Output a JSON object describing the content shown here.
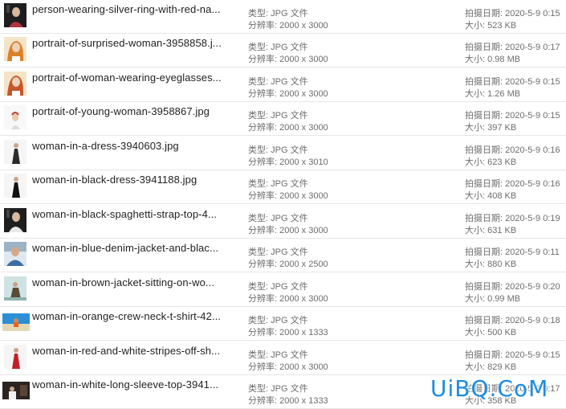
{
  "labels": {
    "type": "类型: ",
    "resolution": "分辨率: ",
    "date_taken": "拍摄日期: ",
    "size": "大小: "
  },
  "files": [
    {
      "name": "person-wearing-silver-ring-with-red-na...",
      "type": "JPG 文件",
      "resolution": "2000 x 3000",
      "date": "2020-5-9 0:15",
      "size": "523 KB",
      "thumb": "portrait-dark",
      "accent": "#b0323c"
    },
    {
      "name": "portrait-of-surprised-woman-3958858.j...",
      "type": "JPG 文件",
      "resolution": "2000 x 3000",
      "date": "2020-5-9 0:17",
      "size": "0.98 MB",
      "thumb": "portrait-warm",
      "accent": "#d9822b"
    },
    {
      "name": "portrait-of-woman-wearing-eyeglasses...",
      "type": "JPG 文件",
      "resolution": "2000 x 3000",
      "date": "2020-5-9 0:15",
      "size": "1.26 MB",
      "thumb": "portrait-warm",
      "accent": "#c8552a"
    },
    {
      "name": "portrait-of-young-woman-3958867.jpg",
      "type": "JPG 文件",
      "resolution": "2000 x 3000",
      "date": "2020-5-9 0:15",
      "size": "397 KB",
      "thumb": "portrait-light",
      "accent": "#c23a3a"
    },
    {
      "name": "woman-in-a-dress-3940603.jpg",
      "type": "JPG 文件",
      "resolution": "2000 x 3010",
      "date": "2020-5-9 0:16",
      "size": "623 KB",
      "thumb": "figure-light",
      "accent": "#2c2c2c"
    },
    {
      "name": "woman-in-black-dress-3941188.jpg",
      "type": "JPG 文件",
      "resolution": "2000 x 3000",
      "date": "2020-5-9 0:16",
      "size": "408 KB",
      "thumb": "figure-light",
      "accent": "#111111"
    },
    {
      "name": "woman-in-black-spaghetti-strap-top-4...",
      "type": "JPG 文件",
      "resolution": "2000 x 3000",
      "date": "2020-5-9 0:19",
      "size": "631 KB",
      "thumb": "portrait-dark",
      "accent": "#e8e8e8"
    },
    {
      "name": "woman-in-blue-denim-jacket-and-blac...",
      "type": "JPG 文件",
      "resolution": "2000 x 2500",
      "date": "2020-5-9 0:11",
      "size": "880 KB",
      "thumb": "portrait-blue",
      "accent": "#3a6ea5"
    },
    {
      "name": "woman-in-brown-jacket-sitting-on-wo...",
      "type": "JPG 文件",
      "resolution": "2000 x 3000",
      "date": "2020-5-9 0:20",
      "size": "0.99 MB",
      "thumb": "figure-teal",
      "accent": "#5b4a3a"
    },
    {
      "name": "woman-in-orange-crew-neck-t-shirt-42...",
      "type": "JPG 文件",
      "resolution": "2000 x 1333",
      "date": "2020-5-9 0:18",
      "size": "500 KB",
      "thumb": "landscape-beach",
      "accent": "#e8641e"
    },
    {
      "name": "woman-in-red-and-white-stripes-off-sh...",
      "type": "JPG 文件",
      "resolution": "2000 x 3000",
      "date": "2020-5-9 0:15",
      "size": "829 KB",
      "thumb": "figure-light",
      "accent": "#c21f2a"
    },
    {
      "name": "woman-in-white-long-sleeve-top-3941...",
      "type": "JPG 文件",
      "resolution": "2000 x 1333",
      "date": "2020-5-9 0:17",
      "size": "358 KB",
      "thumb": "landscape-dark",
      "accent": "#f0f0f0"
    }
  ],
  "watermark": "UiBQ.CoM"
}
